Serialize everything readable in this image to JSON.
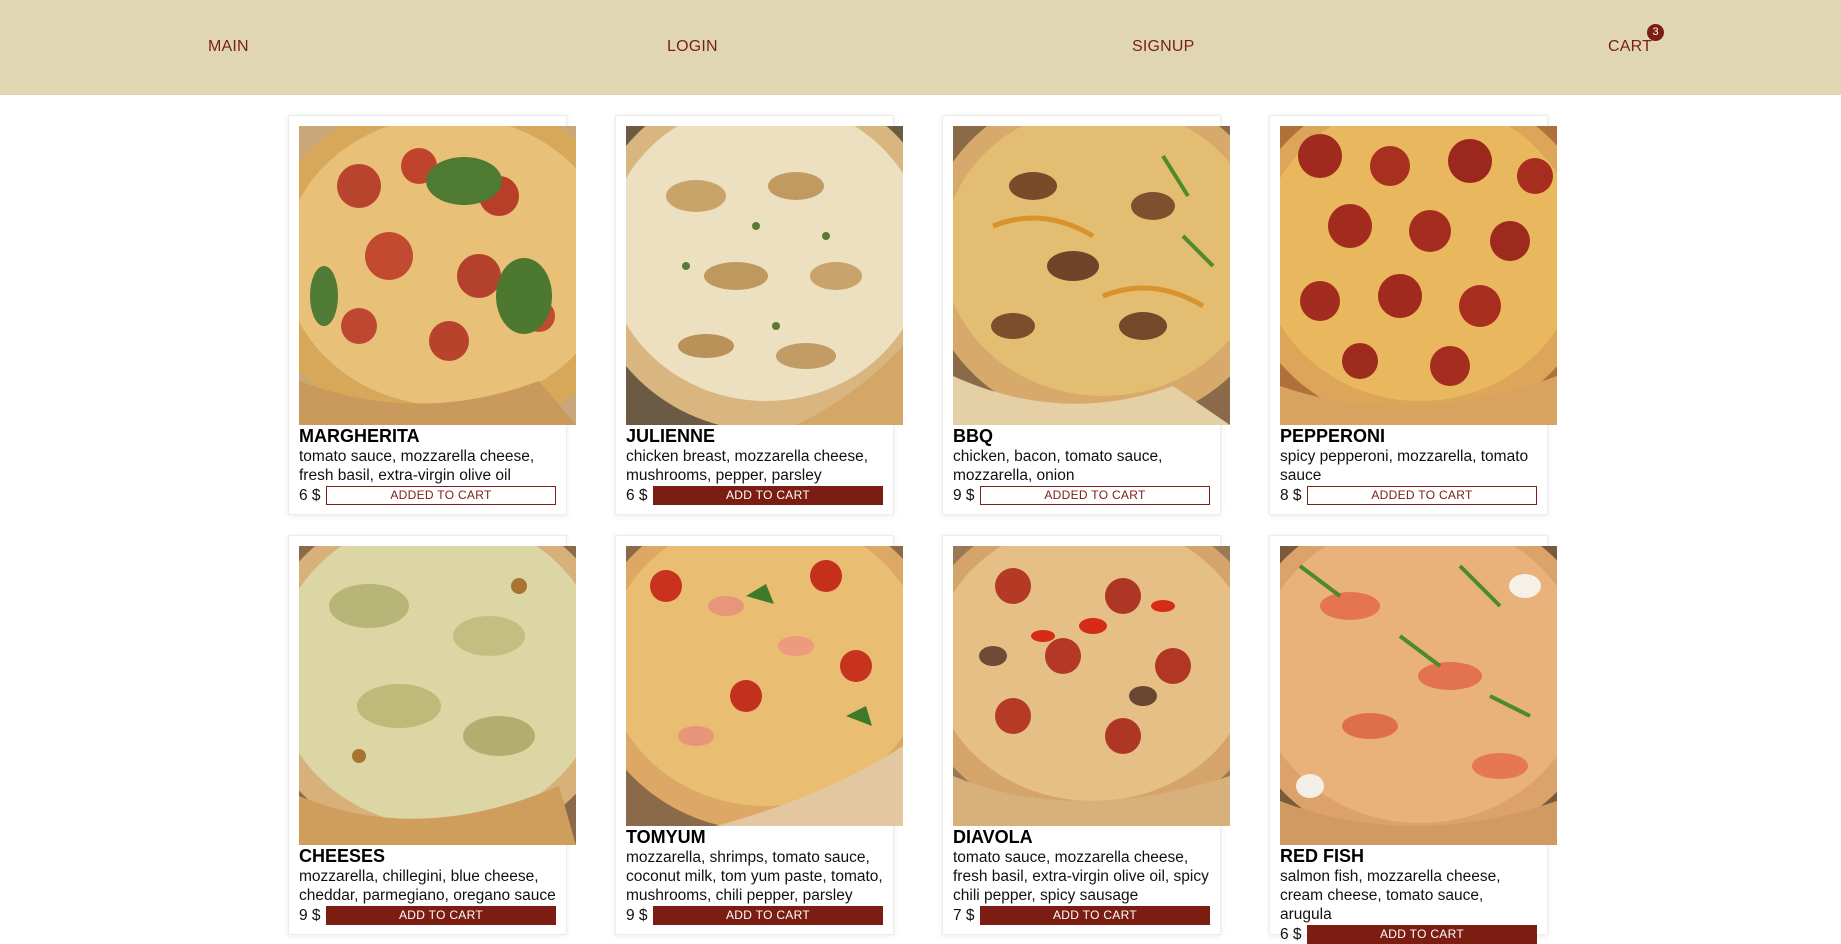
{
  "nav": {
    "main": "MAIN",
    "login": "LOGIN",
    "signup": "SIGNUP",
    "cart": "CART",
    "cart_count": "3"
  },
  "colors": {
    "header_bg": "#e1d6b4",
    "accent": "#7b1d13"
  },
  "pizzas": [
    {
      "name": "MARGHERITA",
      "ingredients": "tomato sauce, mozzarella cheese, fresh basil, extra-virgin olive oil",
      "price": "6 $",
      "button": "ADDED TO CART",
      "state": "added"
    },
    {
      "name": "JULIENNE",
      "ingredients": "chicken breast, mozzarella cheese, mushrooms, pepper, parsley",
      "price": "6 $",
      "button": "ADD TO CART",
      "state": "add"
    },
    {
      "name": "BBQ",
      "ingredients": "chicken, bacon, tomato sauce, mozzarella, onion",
      "price": "9 $",
      "button": "ADDED TO CART",
      "state": "added"
    },
    {
      "name": "PEPPERONI",
      "ingredients": "spicy pepperoni, mozzarella, tomato sauce",
      "price": "8 $",
      "button": "ADDED TO CART",
      "state": "added"
    },
    {
      "name": "CHEESES",
      "ingredients": "mozzarella, chillegini, blue cheese, cheddar, parmegiano, oregano sauce",
      "price": "9 $",
      "button": "ADD TO CART",
      "state": "add"
    },
    {
      "name": "TOMYUM",
      "ingredients": "mozzarella, shrimps, tomato sauce, coconut milk, tom yum paste, tomato, mushrooms, chili pepper, parsley",
      "price": "9 $",
      "button": "ADD TO CART",
      "state": "add"
    },
    {
      "name": "DIAVOLA",
      "ingredients": "tomato sauce, mozzarella cheese, fresh basil, extra-virgin olive oil, spicy chili pepper, spicy sausage",
      "price": "7 $",
      "button": "ADD TO CART",
      "state": "add"
    },
    {
      "name": "RED FISH",
      "ingredients": "salmon fish, mozzarella cheese, cream cheese, tomato sauce, arugula",
      "price": "6 $",
      "button": "ADD TO CART",
      "state": "add"
    }
  ]
}
